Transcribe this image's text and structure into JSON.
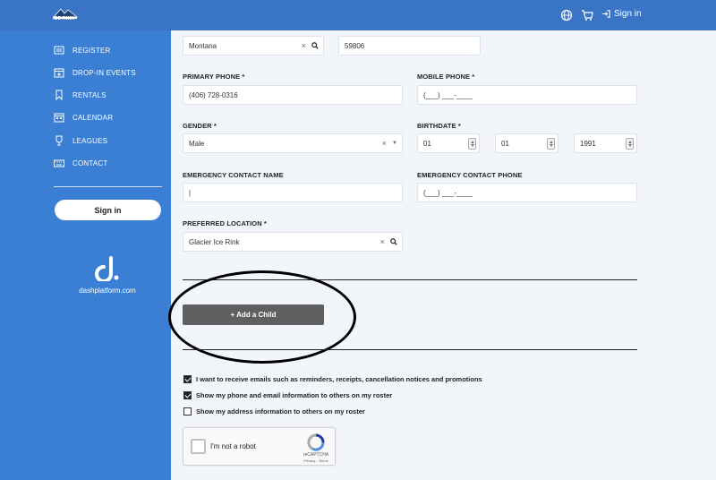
{
  "header": {
    "logo_text": "ICE RINK",
    "sign_in_label": "Sign in"
  },
  "sidebar": {
    "items": [
      {
        "label": "REGISTER",
        "icon": "register-icon"
      },
      {
        "label": "DROP-IN EVENTS",
        "icon": "calendar-plus-icon"
      },
      {
        "label": "RENTALS",
        "icon": "bookmark-icon"
      },
      {
        "label": "CALENDAR",
        "icon": "calendar-icon"
      },
      {
        "label": "LEAGUES",
        "icon": "trophy-icon"
      },
      {
        "label": "CONTACT",
        "icon": "keyboard-icon"
      }
    ],
    "sign_in_label": "Sign in",
    "platform_text": "dashplatform.com"
  },
  "form": {
    "state_value": "Montana",
    "zip_value": "59806",
    "primary_phone_label": "PRIMARY PHONE *",
    "primary_phone_value": "(406) 728-0316",
    "mobile_phone_label": "MOBILE PHONE *",
    "mobile_phone_placeholder": "(___) ___-____",
    "gender_label": "GENDER *",
    "gender_value": "Male",
    "birthdate_label": "BIRTHDATE *",
    "birth_month": "01",
    "birth_day": "01",
    "birth_year": "1991",
    "emergency_name_label": "EMERGENCY CONTACT NAME",
    "emergency_name_value": "|",
    "emergency_phone_label": "EMERGENCY CONTACT PHONE",
    "emergency_phone_placeholder": "(___) ___-____",
    "preferred_location_label": "PREFERRED LOCATION *",
    "preferred_location_value": "Glacier Ice Rink",
    "add_child_label": "+ Add a Child",
    "checkboxes": [
      {
        "label": "I want to receive emails such as reminders, receipts, cancellation notices and promotions",
        "checked": true
      },
      {
        "label": "Show my phone and email information to others on my roster",
        "checked": true
      },
      {
        "label": "Show my address information to others on my roster",
        "checked": false
      }
    ]
  },
  "captcha": {
    "label": "I'm not a robot",
    "brand": "reCAPTCHA",
    "links": "Privacy - Terms"
  },
  "colors": {
    "topbar": "#3a74c4",
    "sidebar": "#3a7fd4",
    "button": "#5f5f5f"
  }
}
